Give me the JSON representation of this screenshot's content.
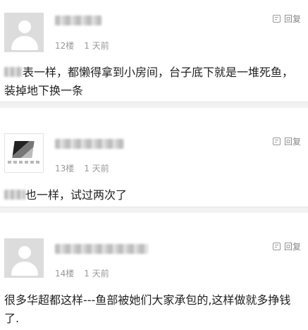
{
  "comments": [
    {
      "floor": "12楼",
      "time": "1 天前",
      "reply_label": "回复",
      "content": "表一样，都懒得拿到小房间，台子底下就是一堆死鱼，装掉地下换一条"
    },
    {
      "floor": "13楼",
      "time": "1 天前",
      "reply_label": "回复",
      "content": "也一样，试过两次了"
    },
    {
      "floor": "14楼",
      "time": "1 天前",
      "reply_label": "回复",
      "content": "很多华超都这样---鱼部被她们大家承包的,这样做就多挣钱了."
    }
  ]
}
